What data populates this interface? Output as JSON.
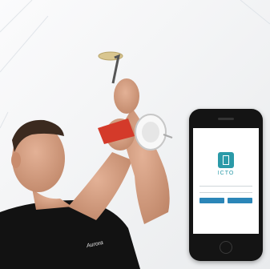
{
  "scene": {
    "description_colors": {
      "ceiling": "#f3f4f5",
      "skin": "#d9a487",
      "shirt": "#111111",
      "tool": "#d43a2a",
      "accent": "#2b9aa8"
    }
  },
  "phone": {
    "app_name": "ICTO",
    "buttons": [
      "",
      ""
    ]
  },
  "shirt_logo": "Aurora"
}
